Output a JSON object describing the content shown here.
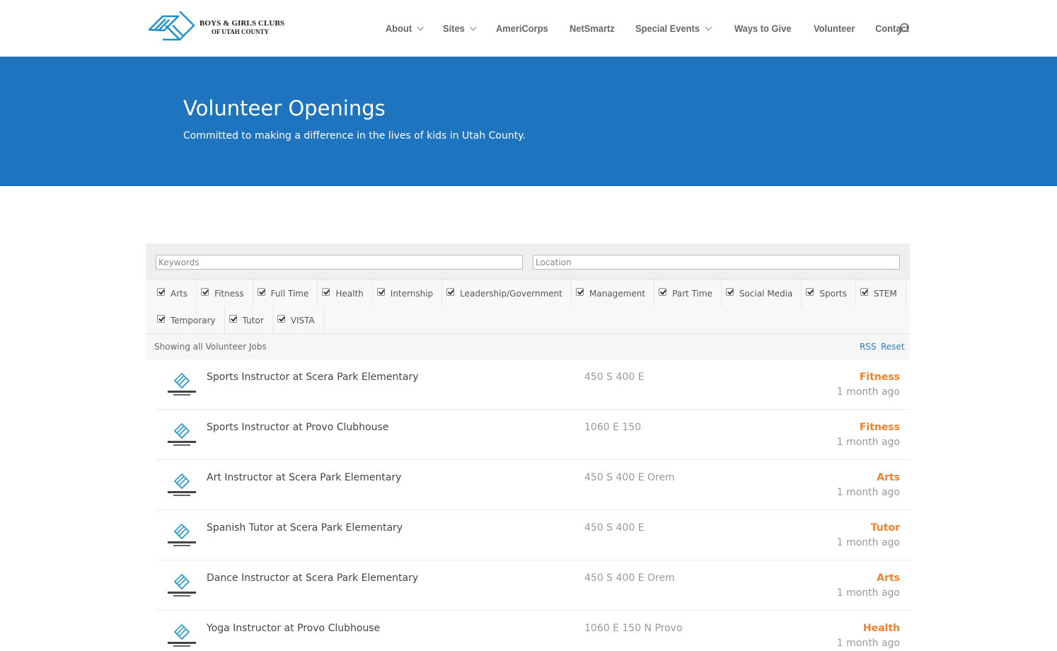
{
  "header": {
    "logo": {
      "line1": "BOYS & GIRLS CLUBS",
      "line2": "OF UTAH COUNTY"
    },
    "nav": [
      {
        "label": "About",
        "dropdown": true
      },
      {
        "label": "Sites",
        "dropdown": true
      },
      {
        "label": "AmeriCorps",
        "dropdown": false
      },
      {
        "label": "NetSmartz",
        "dropdown": false
      },
      {
        "label": "Special Events",
        "dropdown": true
      },
      {
        "label": "Ways to Give",
        "dropdown": false
      },
      {
        "label": "Volunteer",
        "dropdown": false
      },
      {
        "label": "Contact",
        "dropdown": false
      }
    ],
    "search_icon": "search-icon"
  },
  "hero": {
    "title": "Volunteer Openings",
    "subtitle": "Committed to making a difference in the lives of kids in Utah County."
  },
  "filters": {
    "keywords_placeholder": "Keywords",
    "location_placeholder": "Location",
    "categories": [
      "Arts",
      "Fitness",
      "Full Time",
      "Health",
      "Internship",
      "Leadership/Government",
      "Management",
      "Part Time",
      "Social Media",
      "Sports",
      "STEM",
      "Temporary",
      "Tutor",
      "VISTA"
    ],
    "status": "Showing all Volunteer Jobs",
    "rss_label": "RSS",
    "reset_label": "Reset"
  },
  "jobs": [
    {
      "title": "Sports Instructor at Scera Park Elementary",
      "location": "450 S 400 E",
      "category": "Fitness",
      "date": "1 month ago"
    },
    {
      "title": "Sports Instructor at Provo Clubhouse",
      "location": "1060 E 150",
      "category": "Fitness",
      "date": "1 month ago"
    },
    {
      "title": "Art Instructor at Scera Park Elementary",
      "location": "450 S 400 E Orem",
      "category": "Arts",
      "date": "1 month ago"
    },
    {
      "title": "Spanish Tutor at Scera Park Elementary",
      "location": "450 S 400 E",
      "category": "Tutor",
      "date": "1 month ago"
    },
    {
      "title": "Dance Instructor at Scera Park Elementary",
      "location": "450 S 400 E Orem",
      "category": "Arts",
      "date": "1 month ago"
    },
    {
      "title": "Yoga Instructor at Provo Clubhouse",
      "location": "1060 E 150 N Provo",
      "category": "Health",
      "date": "1 month ago"
    }
  ],
  "colors": {
    "hero_bg": "#1e74be",
    "category_accent": "#f0812f",
    "link": "#2a7bc0"
  }
}
